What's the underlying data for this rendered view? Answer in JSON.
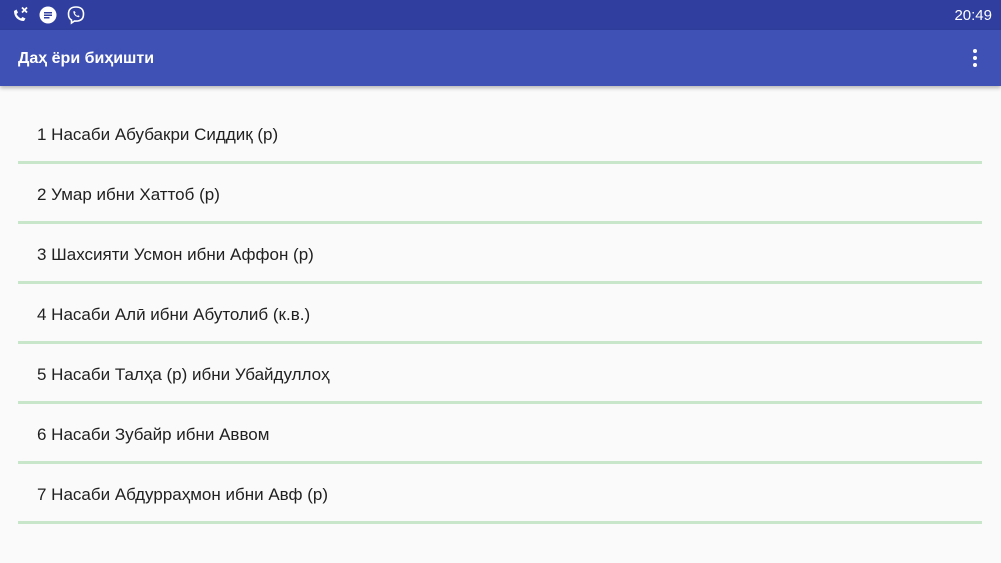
{
  "status_bar": {
    "time": "20:49",
    "icons": [
      "missed-call-icon",
      "message-icon",
      "viber-icon"
    ]
  },
  "app_bar": {
    "title": "Даҳ ёри биҳишти",
    "overflow_icon": "more-vert-icon"
  },
  "list": {
    "items": [
      {
        "label": "1 Насаби Абубакри Сиддиқ (р)"
      },
      {
        "label": "2 Умар ибни Хаттоб (р)"
      },
      {
        "label": "3 Шахсияти Усмон ибни Аффон (р)"
      },
      {
        "label": "4 Насаби Алӣ ибни Абутолиб (к.в.)"
      },
      {
        "label": "5 Насаби Талҳа (р) ибни Убайдуллоҳ"
      },
      {
        "label": "6 Насаби Зубайр ибни Аввом"
      },
      {
        "label": "7 Насаби Абдурраҳмон ибни Авф (р)"
      }
    ]
  },
  "colors": {
    "status_bar": "#303f9f",
    "app_bar": "#3f51b5",
    "divider": "#c8e6c9",
    "background": "#fafafa",
    "text": "#212121"
  }
}
